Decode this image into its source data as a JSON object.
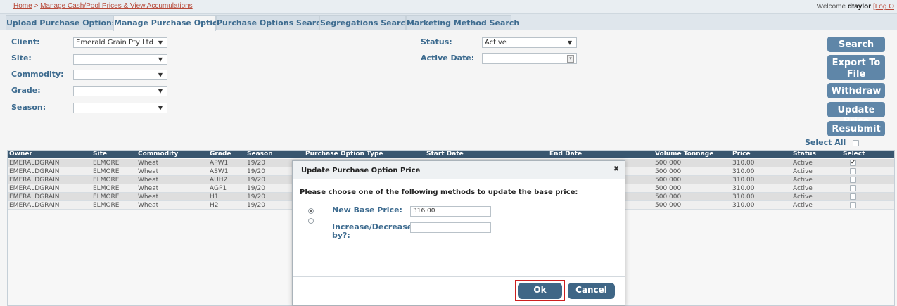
{
  "breadcrumb": {
    "home": "Home",
    "separator": ">",
    "current": "Manage  Cash/Pool  Prices  &  View  Accumulations"
  },
  "user": {
    "welcome": "Welcome",
    "username": "dtaylor",
    "logout": "[Log O"
  },
  "tabs": [
    {
      "label": "Upload Purchase Options"
    },
    {
      "label": "Manage Purchase Options"
    },
    {
      "label": "Purchase Options Search"
    },
    {
      "label": "Segregations Search"
    },
    {
      "label": "Marketing Method Search"
    }
  ],
  "filters": {
    "client_label": "Client:",
    "client_value": "Emerald Grain Pty Ltd",
    "site_label": "Site:",
    "site_value": "",
    "commodity_label": "Commodity:",
    "commodity_value": "",
    "grade_label": "Grade:",
    "grade_value": "",
    "season_label": "Season:",
    "season_value": "",
    "status_label": "Status:",
    "status_value": "Active",
    "active_date_label": "Active Date:",
    "active_date_value": ""
  },
  "actions": {
    "search": "Search",
    "export": "Export To File",
    "withdraw": "Withdraw",
    "update_price": "Update Price",
    "resubmit": "Resubmit",
    "select_all": "Select All"
  },
  "grid": {
    "headers": [
      "Owner",
      "Site",
      "Commodity",
      "Grade",
      "Season",
      "Purchase Option Type",
      "Start Date",
      "End Date",
      "Volume Tonnage",
      "Price",
      "Status",
      "Select"
    ],
    "rows": [
      {
        "owner": "EMERALDGRAIN",
        "site": "ELMORE",
        "commodity": "Wheat",
        "grade": "APW1",
        "season": "19/20",
        "volume": "500.000",
        "price": "310.00",
        "status": "Active",
        "selected": true
      },
      {
        "owner": "EMERALDGRAIN",
        "site": "ELMORE",
        "commodity": "Wheat",
        "grade": "ASW1",
        "season": "19/20",
        "volume": "500.000",
        "price": "310.00",
        "status": "Active",
        "selected": false
      },
      {
        "owner": "EMERALDGRAIN",
        "site": "ELMORE",
        "commodity": "Wheat",
        "grade": "AUH2",
        "season": "19/20",
        "volume": "500.000",
        "price": "310.00",
        "status": "Active",
        "selected": false
      },
      {
        "owner": "EMERALDGRAIN",
        "site": "ELMORE",
        "commodity": "Wheat",
        "grade": "AGP1",
        "season": "19/20",
        "volume": "500.000",
        "price": "310.00",
        "status": "Active",
        "selected": false
      },
      {
        "owner": "EMERALDGRAIN",
        "site": "ELMORE",
        "commodity": "Wheat",
        "grade": "H1",
        "season": "19/20",
        "volume": "500.000",
        "price": "310.00",
        "status": "Active",
        "selected": false
      },
      {
        "owner": "EMERALDGRAIN",
        "site": "ELMORE",
        "commodity": "Wheat",
        "grade": "H2",
        "season": "19/20",
        "volume": "500.000",
        "price": "310.00",
        "status": "Active",
        "selected": false
      }
    ]
  },
  "modal": {
    "title": "Update Purchase Option Price",
    "close": "✖",
    "prompt": "Please choose one of the following methods to update the base price:",
    "new_base_label": "New Base Price:",
    "new_base_value": "316.00",
    "increase_label": "Increase/Decrease by?:",
    "increase_value": "",
    "ok": "Ok",
    "cancel": "Cancel"
  },
  "colors": {
    "accent": "#3d6b8f",
    "button": "#5f86a8",
    "grid_header": "#39566f",
    "highlight": "#cc1f1f"
  }
}
